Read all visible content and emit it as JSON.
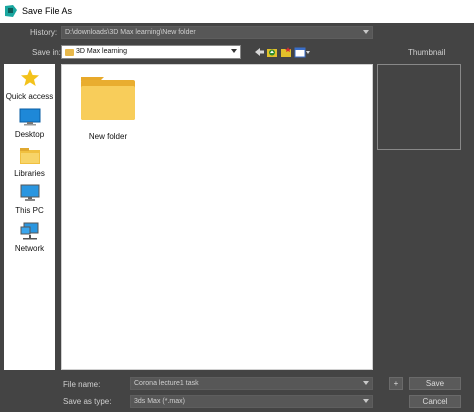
{
  "window": {
    "title": "Save File As"
  },
  "history": {
    "label": "History:",
    "value": "D:\\downloads\\3D Max learning\\New folder"
  },
  "save_in": {
    "label": "Save in:",
    "value": "3D Max learning"
  },
  "thumbnail": {
    "label": "Thumbnail"
  },
  "places": [
    {
      "label": "Quick access",
      "icon": "star-icon"
    },
    {
      "label": "Desktop",
      "icon": "desktop-icon"
    },
    {
      "label": "Libraries",
      "icon": "libraries-icon"
    },
    {
      "label": "This PC",
      "icon": "computer-icon"
    },
    {
      "label": "Network",
      "icon": "network-icon"
    }
  ],
  "files": [
    {
      "name": "New folder",
      "icon": "folder-icon"
    }
  ],
  "file_name": {
    "label": "File name:",
    "value": "Corona lecture1 task"
  },
  "save_as_type": {
    "label": "Save as type:",
    "value": "3ds Max (*.max)"
  },
  "buttons": {
    "plus": "+",
    "save": "Save",
    "cancel": "Cancel"
  },
  "colors": {
    "background": "#444444",
    "accent_folder": "#f5c542",
    "app_icon": "#1aa7a0"
  }
}
